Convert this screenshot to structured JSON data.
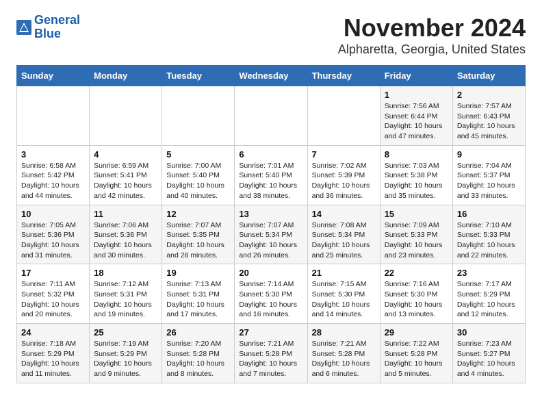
{
  "header": {
    "logo_line1": "General",
    "logo_line2": "Blue",
    "month": "November 2024",
    "location": "Alpharetta, Georgia, United States"
  },
  "days_of_week": [
    "Sunday",
    "Monday",
    "Tuesday",
    "Wednesday",
    "Thursday",
    "Friday",
    "Saturday"
  ],
  "weeks": [
    [
      {
        "day": "",
        "info": ""
      },
      {
        "day": "",
        "info": ""
      },
      {
        "day": "",
        "info": ""
      },
      {
        "day": "",
        "info": ""
      },
      {
        "day": "",
        "info": ""
      },
      {
        "day": "1",
        "info": "Sunrise: 7:56 AM\nSunset: 6:44 PM\nDaylight: 10 hours and 47 minutes."
      },
      {
        "day": "2",
        "info": "Sunrise: 7:57 AM\nSunset: 6:43 PM\nDaylight: 10 hours and 45 minutes."
      }
    ],
    [
      {
        "day": "3",
        "info": "Sunrise: 6:58 AM\nSunset: 5:42 PM\nDaylight: 10 hours and 44 minutes."
      },
      {
        "day": "4",
        "info": "Sunrise: 6:59 AM\nSunset: 5:41 PM\nDaylight: 10 hours and 42 minutes."
      },
      {
        "day": "5",
        "info": "Sunrise: 7:00 AM\nSunset: 5:40 PM\nDaylight: 10 hours and 40 minutes."
      },
      {
        "day": "6",
        "info": "Sunrise: 7:01 AM\nSunset: 5:40 PM\nDaylight: 10 hours and 38 minutes."
      },
      {
        "day": "7",
        "info": "Sunrise: 7:02 AM\nSunset: 5:39 PM\nDaylight: 10 hours and 36 minutes."
      },
      {
        "day": "8",
        "info": "Sunrise: 7:03 AM\nSunset: 5:38 PM\nDaylight: 10 hours and 35 minutes."
      },
      {
        "day": "9",
        "info": "Sunrise: 7:04 AM\nSunset: 5:37 PM\nDaylight: 10 hours and 33 minutes."
      }
    ],
    [
      {
        "day": "10",
        "info": "Sunrise: 7:05 AM\nSunset: 5:36 PM\nDaylight: 10 hours and 31 minutes."
      },
      {
        "day": "11",
        "info": "Sunrise: 7:06 AM\nSunset: 5:36 PM\nDaylight: 10 hours and 30 minutes."
      },
      {
        "day": "12",
        "info": "Sunrise: 7:07 AM\nSunset: 5:35 PM\nDaylight: 10 hours and 28 minutes."
      },
      {
        "day": "13",
        "info": "Sunrise: 7:07 AM\nSunset: 5:34 PM\nDaylight: 10 hours and 26 minutes."
      },
      {
        "day": "14",
        "info": "Sunrise: 7:08 AM\nSunset: 5:34 PM\nDaylight: 10 hours and 25 minutes."
      },
      {
        "day": "15",
        "info": "Sunrise: 7:09 AM\nSunset: 5:33 PM\nDaylight: 10 hours and 23 minutes."
      },
      {
        "day": "16",
        "info": "Sunrise: 7:10 AM\nSunset: 5:33 PM\nDaylight: 10 hours and 22 minutes."
      }
    ],
    [
      {
        "day": "17",
        "info": "Sunrise: 7:11 AM\nSunset: 5:32 PM\nDaylight: 10 hours and 20 minutes."
      },
      {
        "day": "18",
        "info": "Sunrise: 7:12 AM\nSunset: 5:31 PM\nDaylight: 10 hours and 19 minutes."
      },
      {
        "day": "19",
        "info": "Sunrise: 7:13 AM\nSunset: 5:31 PM\nDaylight: 10 hours and 17 minutes."
      },
      {
        "day": "20",
        "info": "Sunrise: 7:14 AM\nSunset: 5:30 PM\nDaylight: 10 hours and 16 minutes."
      },
      {
        "day": "21",
        "info": "Sunrise: 7:15 AM\nSunset: 5:30 PM\nDaylight: 10 hours and 14 minutes."
      },
      {
        "day": "22",
        "info": "Sunrise: 7:16 AM\nSunset: 5:30 PM\nDaylight: 10 hours and 13 minutes."
      },
      {
        "day": "23",
        "info": "Sunrise: 7:17 AM\nSunset: 5:29 PM\nDaylight: 10 hours and 12 minutes."
      }
    ],
    [
      {
        "day": "24",
        "info": "Sunrise: 7:18 AM\nSunset: 5:29 PM\nDaylight: 10 hours and 11 minutes."
      },
      {
        "day": "25",
        "info": "Sunrise: 7:19 AM\nSunset: 5:29 PM\nDaylight: 10 hours and 9 minutes."
      },
      {
        "day": "26",
        "info": "Sunrise: 7:20 AM\nSunset: 5:28 PM\nDaylight: 10 hours and 8 minutes."
      },
      {
        "day": "27",
        "info": "Sunrise: 7:21 AM\nSunset: 5:28 PM\nDaylight: 10 hours and 7 minutes."
      },
      {
        "day": "28",
        "info": "Sunrise: 7:21 AM\nSunset: 5:28 PM\nDaylight: 10 hours and 6 minutes."
      },
      {
        "day": "29",
        "info": "Sunrise: 7:22 AM\nSunset: 5:28 PM\nDaylight: 10 hours and 5 minutes."
      },
      {
        "day": "30",
        "info": "Sunrise: 7:23 AM\nSunset: 5:27 PM\nDaylight: 10 hours and 4 minutes."
      }
    ]
  ]
}
